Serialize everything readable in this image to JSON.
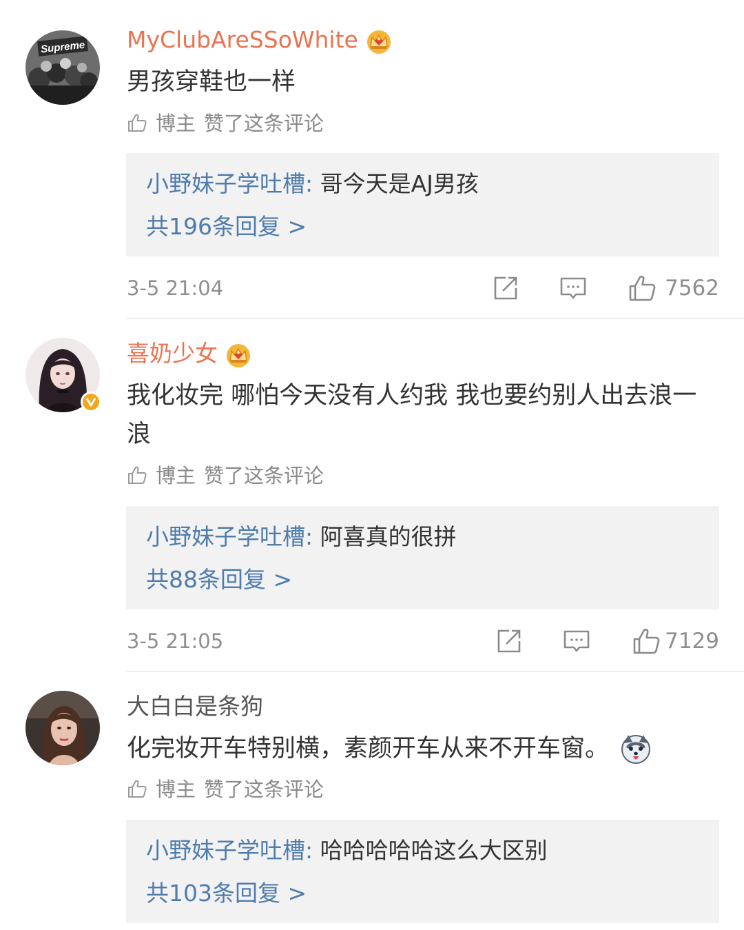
{
  "colors": {
    "username_vip": "#eb7350",
    "reply_link": "#4f7cad",
    "reply_bg": "#f2f2f2",
    "meta_gray": "#8e8e8e",
    "verified_badge": "#f2a81d"
  },
  "avatar_text": "Supreme",
  "comments": [
    {
      "username": "MyClubAreSSoWhite",
      "vip_icon": "crown-icon",
      "text": "男孩穿鞋也一样",
      "liked_by": "博主",
      "liked_label": "赞了这条评论",
      "reply": {
        "author": "小野妹子学吐槽",
        "sep": ": ",
        "text": "哥今天是AJ男孩",
        "count_label": "共196条回复 >"
      },
      "time": "3-5 21:04",
      "likes": "7562"
    },
    {
      "username": "喜奶少女",
      "vip_icon": "crown-icon",
      "text": "我化妆完 哪怕今天没有人约我 我也要约别人出去浪一浪",
      "liked_by": "博主",
      "liked_label": "赞了这条评论",
      "reply": {
        "author": "小野妹子学吐槽",
        "sep": ": ",
        "text": "阿喜真的很拼",
        "count_label": "共88条回复 >"
      },
      "time": "3-5 21:05",
      "likes": "7129"
    },
    {
      "username": "大白白是条狗",
      "text": "化完妆开车特别横，素颜开车从来不开车窗。",
      "emoji": "husky-emoji",
      "liked_by": "博主",
      "liked_label": "赞了这条评论",
      "reply": {
        "author": "小野妹子学吐槽",
        "sep": ": ",
        "text": "哈哈哈哈哈这么大区别",
        "count_label": "共103条回复 >"
      }
    }
  ]
}
